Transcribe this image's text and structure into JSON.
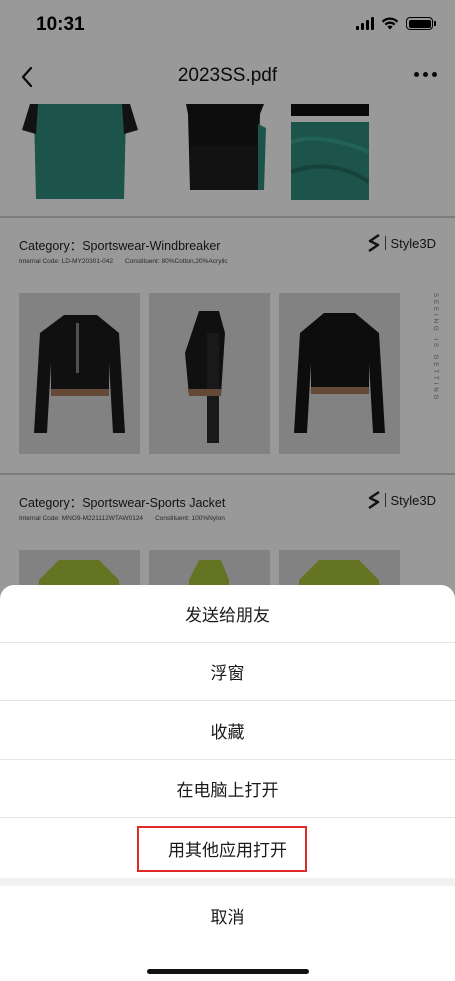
{
  "status_bar": {
    "time": "10:31"
  },
  "nav": {
    "title": "2023SS.pdf"
  },
  "document": {
    "pages": [
      {
        "category": "Category：Sportswear-Windbreaker",
        "internal_code_label": "Internal Code:",
        "internal_code": "LD-MY20301-042",
        "constituent_label": "Constituent:",
        "constituent": "80%Cotton,20%Acrylic",
        "brand": "Style3D"
      },
      {
        "category": "Category：Sportswear-Sports Jacket",
        "internal_code_label": "Internal Code:",
        "internal_code": "MNO9-M221112WTAW0124",
        "constituent_label": "Constituent:",
        "constituent": "100%Nylon",
        "brand": "Style3D"
      }
    ],
    "side_text": "SEEING IS GETTING"
  },
  "action_sheet": {
    "items": [
      "发送给朋友",
      "浮窗",
      "收藏",
      "在电脑上打开",
      "用其他应用打开"
    ],
    "cancel": "取消"
  },
  "colors": {
    "highlight": "#e02a2a",
    "garment_teal": "#2f8a7c",
    "garment_lime": "#a8c23a"
  }
}
